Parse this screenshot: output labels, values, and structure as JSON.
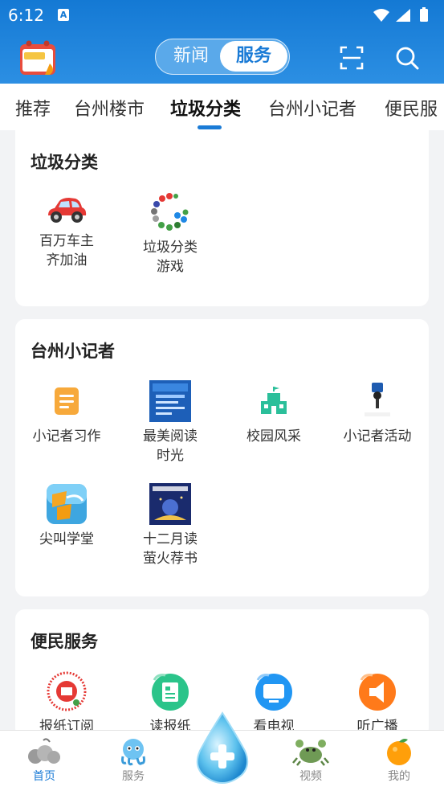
{
  "status": {
    "time": "6:12",
    "notif_icon": "A"
  },
  "header": {
    "seg_news": "新闻",
    "seg_service": "服务"
  },
  "tabs": [
    "推荐",
    "台州楼市",
    "垃圾分类",
    "台州小记者",
    "便民服"
  ],
  "cards": {
    "garbage": {
      "title": "垃圾分类",
      "items": [
        {
          "label1": "百万车主",
          "label2": "齐加油"
        },
        {
          "label1": "垃圾分类",
          "label2": "游戏"
        }
      ]
    },
    "reporter": {
      "title": "台州小记者",
      "items": [
        {
          "label1": "小记者习作",
          "label2": ""
        },
        {
          "label1": "最美阅读",
          "label2": "时光"
        },
        {
          "label1": "校园风采",
          "label2": ""
        },
        {
          "label1": "小记者活动",
          "label2": ""
        },
        {
          "label1": "尖叫学堂",
          "label2": ""
        },
        {
          "label1": "十二月读",
          "label2": "萤火荐书"
        }
      ]
    },
    "service": {
      "title": "便民服务",
      "items": [
        {
          "label": "报纸订阅"
        },
        {
          "label": "读报纸"
        },
        {
          "label": "看电视"
        },
        {
          "label": "听广播"
        }
      ]
    }
  },
  "bottom_nav": [
    {
      "label": "首页"
    },
    {
      "label": "服务"
    },
    {
      "label": "视频"
    },
    {
      "label": "我的"
    }
  ],
  "colors": {
    "brand": "#1a7bd6",
    "active_nav": "#1a7bd6"
  }
}
